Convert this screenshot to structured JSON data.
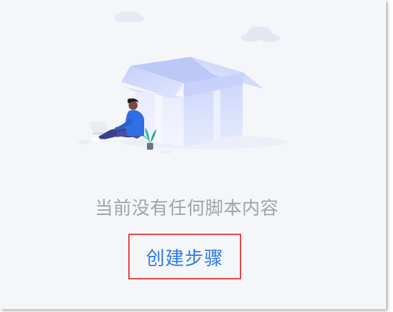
{
  "empty_state": {
    "message": "当前没有任何脚本内容",
    "create_label": "创建步骤"
  },
  "colors": {
    "panel_bg": "#f5f6fa",
    "message_text": "#9ea3ab",
    "link_text": "#2f7be6",
    "highlight_border": "#e64545",
    "box_light": "#d7defb",
    "box_dark": "#b7c3f4",
    "person_shirt": "#2f6ee6",
    "person_pants": "#3a3f8f"
  },
  "icons": {
    "illustration": "empty-box-person-illustration"
  }
}
